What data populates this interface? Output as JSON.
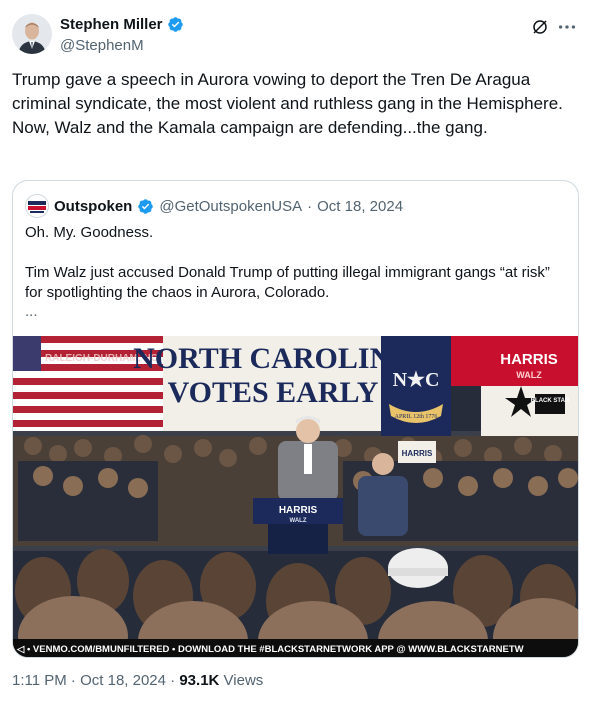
{
  "author": {
    "name": "Stephen Miller",
    "handle": "@StephenM"
  },
  "tweet": {
    "text": "Trump gave a speech in Aurora vowing to deport the Tren De Aragua criminal syndicate, the most violent and ruthless gang in the Hemisphere. Now, Walz and the Kamala campaign are defending...the gang."
  },
  "quote": {
    "name": "Outspoken",
    "handle": "@GetOutspokenUSA",
    "date": "Oct 18, 2024",
    "line1": "Oh. My. Goodness.",
    "line2": "Tim Walz just accused Donald Trump of putting illegal immigrant gangs “at risk” for spotlighting the chaos in Aurora, Colorado.",
    "ellipsis": "...",
    "logo_text": "OUT SPOKEN"
  },
  "media": {
    "banner_city": "RALEIGH-DURHAM, NC",
    "banner_line1": "NORTH CAROLINA",
    "banner_line2": "VOTES EARLY",
    "flag_letters": "N★C",
    "flag_date": "APRIL 12th 1776",
    "sign_top": "HARRIS",
    "sign_sub": "WALZ",
    "podium_top": "HARRIS",
    "podium_sub": "WALZ",
    "star_logo": "BLACK STAR",
    "sign_small": "WALZ",
    "crowd_sign": "HARRIS",
    "ticker": "◁ • VENMO.COM/BMUNFILTERED • DOWNLOAD THE #BLACKSTARNETWORK APP @ WWW.BLACKSTARNETW"
  },
  "footer": {
    "time": "1:11 PM",
    "sep1": "·",
    "date": "Oct 18, 2024",
    "sep2": "·",
    "views": "93.1K",
    "views_label": "Views"
  },
  "colors": {
    "verified": "#1d9bf0",
    "text": "#0f1419",
    "muted": "#536471",
    "border": "#cfd9de",
    "banner_navy": "#1b2a5a",
    "nc_red": "#c8102e"
  }
}
